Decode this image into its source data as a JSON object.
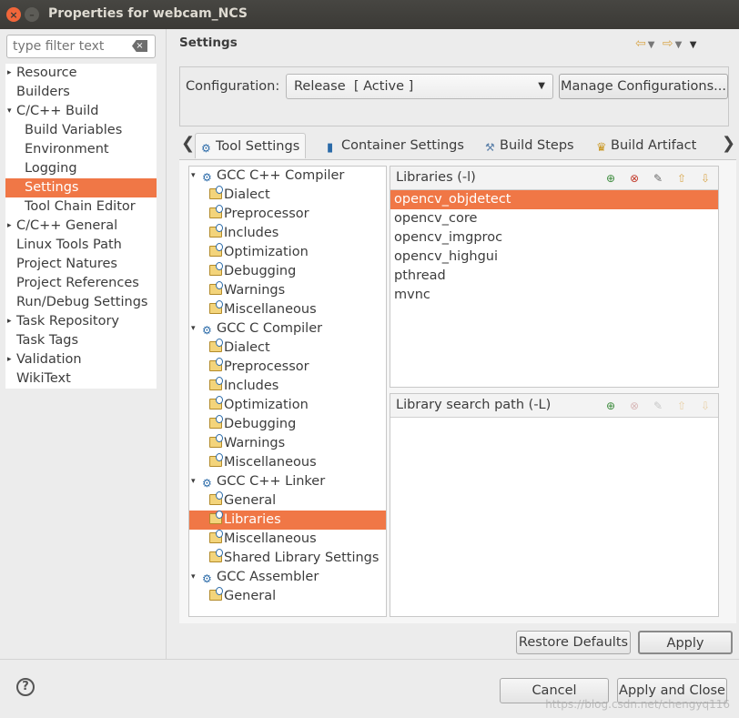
{
  "window": {
    "title": "Properties for webcam_NCS"
  },
  "filter": {
    "placeholder": "type filter text"
  },
  "nav": [
    {
      "label": "Resource",
      "indent": 1,
      "arrow": true,
      "selected": false
    },
    {
      "label": "Builders",
      "indent": 1,
      "arrow": false,
      "selected": false
    },
    {
      "label": "C/C++ Build",
      "indent": 1,
      "arrow": true,
      "expanded": true,
      "selected": false
    },
    {
      "label": "Build Variables",
      "indent": 2,
      "arrow": false,
      "selected": false
    },
    {
      "label": "Environment",
      "indent": 2,
      "arrow": false,
      "selected": false
    },
    {
      "label": "Logging",
      "indent": 2,
      "arrow": false,
      "selected": false
    },
    {
      "label": "Settings",
      "indent": 2,
      "arrow": false,
      "selected": true
    },
    {
      "label": "Tool Chain Editor",
      "indent": 2,
      "arrow": false,
      "selected": false
    },
    {
      "label": "C/C++ General",
      "indent": 1,
      "arrow": true,
      "selected": false
    },
    {
      "label": "Linux Tools Path",
      "indent": 1,
      "arrow": false,
      "selected": false
    },
    {
      "label": "Project Natures",
      "indent": 1,
      "arrow": false,
      "selected": false
    },
    {
      "label": "Project References",
      "indent": 1,
      "arrow": false,
      "selected": false
    },
    {
      "label": "Run/Debug Settings",
      "indent": 1,
      "arrow": false,
      "selected": false
    },
    {
      "label": "Task Repository",
      "indent": 1,
      "arrow": true,
      "selected": false
    },
    {
      "label": "Task Tags",
      "indent": 1,
      "arrow": false,
      "selected": false
    },
    {
      "label": "Validation",
      "indent": 1,
      "arrow": true,
      "selected": false
    },
    {
      "label": "WikiText",
      "indent": 1,
      "arrow": false,
      "selected": false
    }
  ],
  "settings": {
    "title": "Settings",
    "configuration_label": "Configuration:",
    "configuration_value": "Release  [ Active ]",
    "manage_label": "Manage Configurations..."
  },
  "tabs": [
    {
      "label": "Tool Settings",
      "active": true
    },
    {
      "label": "Container Settings",
      "active": false
    },
    {
      "label": "Build Steps",
      "active": false
    },
    {
      "label": "Build Artifact",
      "active": false
    }
  ],
  "tool_tree": [
    {
      "label": "GCC C++ Compiler",
      "type": "tool"
    },
    {
      "label": "Dialect",
      "type": "option"
    },
    {
      "label": "Preprocessor",
      "type": "option"
    },
    {
      "label": "Includes",
      "type": "option"
    },
    {
      "label": "Optimization",
      "type": "option"
    },
    {
      "label": "Debugging",
      "type": "option"
    },
    {
      "label": "Warnings",
      "type": "option"
    },
    {
      "label": "Miscellaneous",
      "type": "option"
    },
    {
      "label": "GCC C Compiler",
      "type": "tool"
    },
    {
      "label": "Dialect",
      "type": "option"
    },
    {
      "label": "Preprocessor",
      "type": "option"
    },
    {
      "label": "Includes",
      "type": "option"
    },
    {
      "label": "Optimization",
      "type": "option"
    },
    {
      "label": "Debugging",
      "type": "option"
    },
    {
      "label": "Warnings",
      "type": "option"
    },
    {
      "label": "Miscellaneous",
      "type": "option"
    },
    {
      "label": "GCC C++ Linker",
      "type": "tool"
    },
    {
      "label": "General",
      "type": "option"
    },
    {
      "label": "Libraries",
      "type": "option",
      "selected": true
    },
    {
      "label": "Miscellaneous",
      "type": "option"
    },
    {
      "label": "Shared Library Settings",
      "type": "option"
    },
    {
      "label": "GCC Assembler",
      "type": "tool"
    },
    {
      "label": "General",
      "type": "option"
    }
  ],
  "libraries": {
    "title": "Libraries (-l)",
    "items": [
      "opencv_objdetect",
      "opencv_core",
      "opencv_imgproc",
      "opencv_highgui",
      "pthread",
      "mvnc"
    ],
    "selected_index": 0
  },
  "search_path": {
    "title": "Library search path (-L)",
    "items": []
  },
  "buttons": {
    "restore": "Restore Defaults",
    "apply": "Apply",
    "cancel": "Cancel",
    "apply_close": "Apply and Close",
    "help": "?"
  },
  "watermark": "https://blog.csdn.net/chengyq116",
  "colors": {
    "selection": "#f07746",
    "close": "#f0663a"
  }
}
